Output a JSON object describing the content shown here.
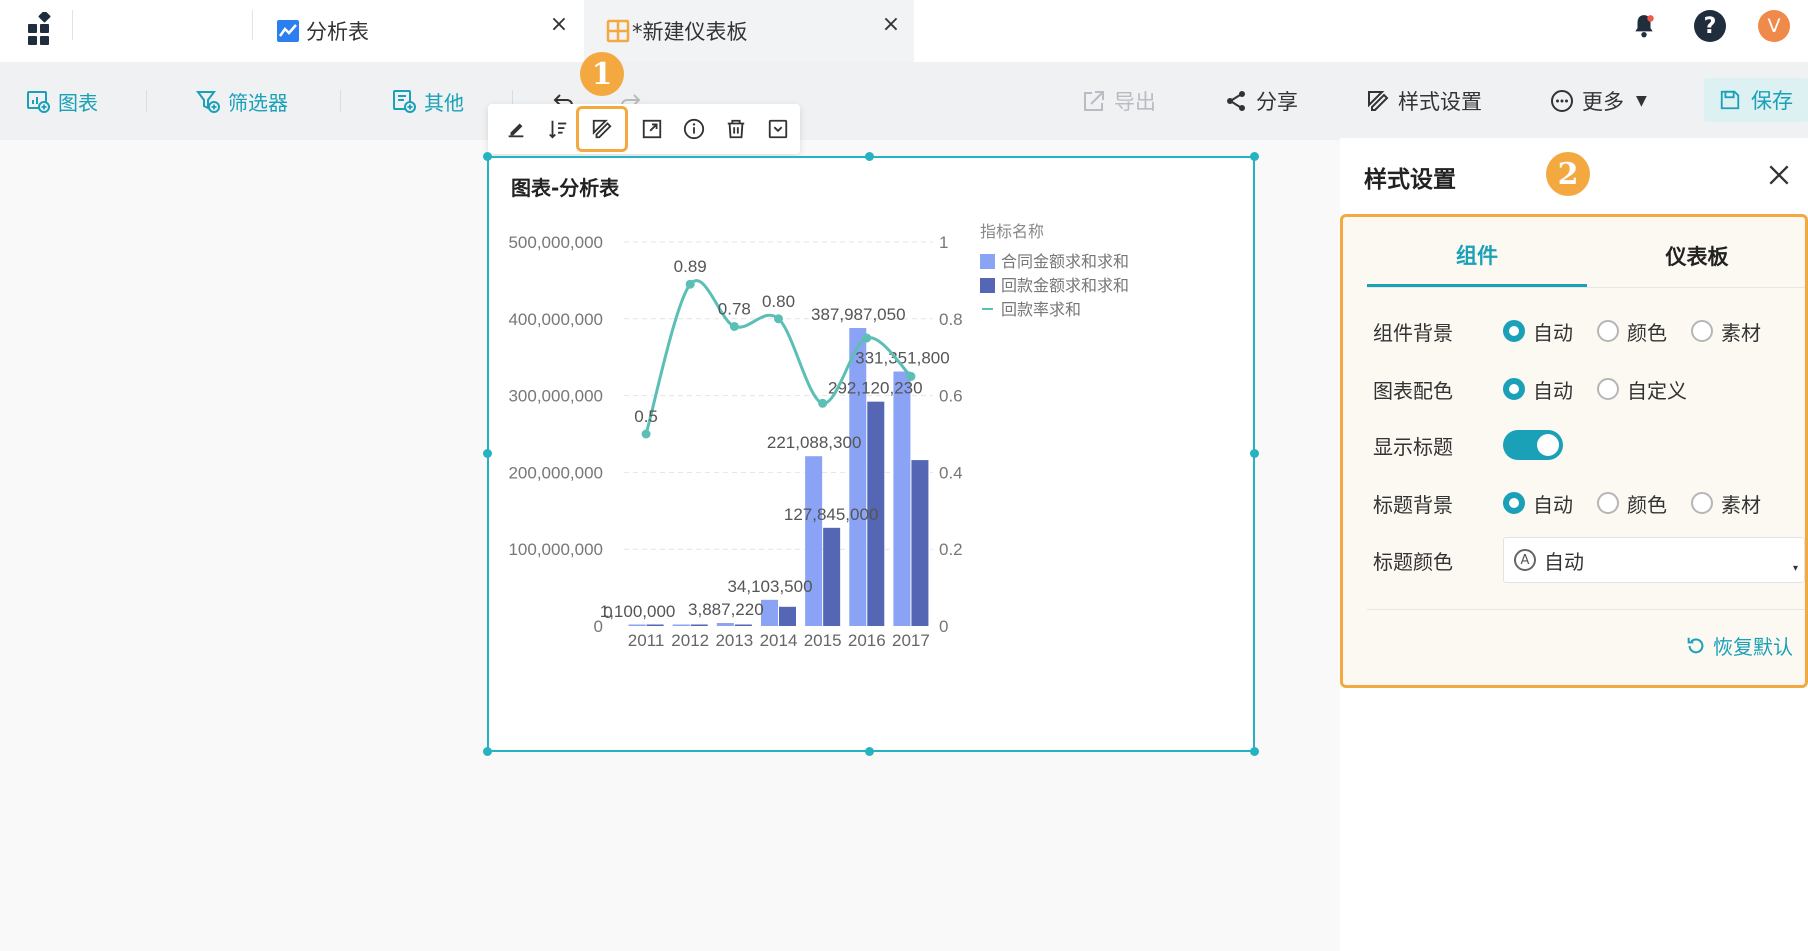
{
  "tabs": [
    {
      "label": "分析表"
    },
    {
      "label": "*新建仪表板"
    }
  ],
  "avatar_letter": "V",
  "toolbar": {
    "chart": "图表",
    "filter": "筛选器",
    "other": "其他",
    "export": "导出",
    "share": "分享",
    "style": "样式设置",
    "more": "更多",
    "save": "保存"
  },
  "markers": {
    "one": "1",
    "two": "2"
  },
  "widget": {
    "title": "图表-分析表"
  },
  "chart_data": {
    "type": "bar",
    "categories": [
      "2011",
      "2012",
      "2013",
      "2014",
      "2015",
      "2016",
      "2017"
    ],
    "series": [
      {
        "name": "合同金额求和求和",
        "type": "bar",
        "axis": "left",
        "color": "#8aa3f5",
        "values": [
          1100000,
          1100000,
          3887220,
          34103500,
          221088300,
          387987050,
          331351800
        ],
        "labels": [
          "1,100,000",
          "",
          "3,887,220",
          "34,103,500",
          "221,088,300",
          "387,987,050",
          "331,351,800"
        ]
      },
      {
        "name": "回款金额求和求和",
        "type": "bar",
        "axis": "left",
        "color": "#5566b4",
        "values": [
          0,
          0,
          0,
          25000000,
          127845000,
          292120230,
          216000000
        ],
        "labels": [
          "0",
          "",
          "",
          "",
          "127,845,000",
          "292,120,230",
          ""
        ]
      },
      {
        "name": "回款率求和",
        "type": "line",
        "axis": "right",
        "color": "#5bbfb5",
        "values": [
          0.5,
          0.89,
          0.78,
          0.8,
          0.58,
          0.75,
          0.65
        ],
        "labels": [
          "0.5",
          "0.89",
          "0.78",
          "0.80",
          "",
          "",
          ""
        ]
      }
    ],
    "legend_title": "指标名称",
    "left_ticks": [
      "0",
      "100,000,000",
      "200,000,000",
      "300,000,000",
      "400,000,000",
      "500,000,000"
    ],
    "right_ticks": [
      "0",
      "0.2",
      "0.4",
      "0.6",
      "0.8",
      "1"
    ],
    "ylim_left": [
      0,
      500000000
    ],
    "ylim_right": [
      0,
      1
    ],
    "legend_position": "top-right",
    "grid": true
  },
  "panel": {
    "title": "样式设置",
    "tab_component": "组件",
    "tab_dashboard": "仪表板",
    "rows": {
      "component_bg": {
        "label": "组件背景",
        "options": [
          "自动",
          "颜色",
          "素材"
        ]
      },
      "chart_color": {
        "label": "图表配色",
        "options": [
          "自动",
          "自定义"
        ]
      },
      "show_title": {
        "label": "显示标题"
      },
      "title_bg": {
        "label": "标题背景",
        "options": [
          "自动",
          "颜色",
          "素材"
        ]
      },
      "title_color": {
        "label": "标题颜色",
        "value": "自动"
      }
    },
    "restore": "恢复默认"
  },
  "colors": {
    "accent": "#1aa1b8",
    "highlight": "#f4a840"
  }
}
